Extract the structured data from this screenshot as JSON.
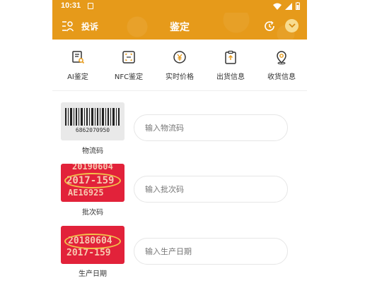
{
  "status_bar": {
    "time": "10:31"
  },
  "header": {
    "complain_label": "投诉",
    "title": "鉴定"
  },
  "features": [
    {
      "label": "AI鉴定",
      "icon": "ai-document-icon"
    },
    {
      "label": "NFC鉴定",
      "icon": "nfc-scan-icon"
    },
    {
      "label": "实时价格",
      "icon": "yen-price-icon"
    },
    {
      "label": "出货信息",
      "icon": "clipboard-upload-icon"
    },
    {
      "label": "收货信息",
      "icon": "location-pin-icon"
    }
  ],
  "rows": [
    {
      "caption": "物流码",
      "placeholder": "输入物流码",
      "image_text": "6862070950"
    },
    {
      "caption": "批次码",
      "placeholder": "输入批次码",
      "image_lines": [
        "20190604",
        "2017-159",
        "AE16925"
      ]
    },
    {
      "caption": "生产日期",
      "placeholder": "输入生产日期",
      "image_lines": [
        "20180604",
        "2017-159"
      ]
    }
  ],
  "colors": {
    "brand": "#e69a1a",
    "highlight_oval": "#f2c24a",
    "sample_red": "#e2223a"
  }
}
